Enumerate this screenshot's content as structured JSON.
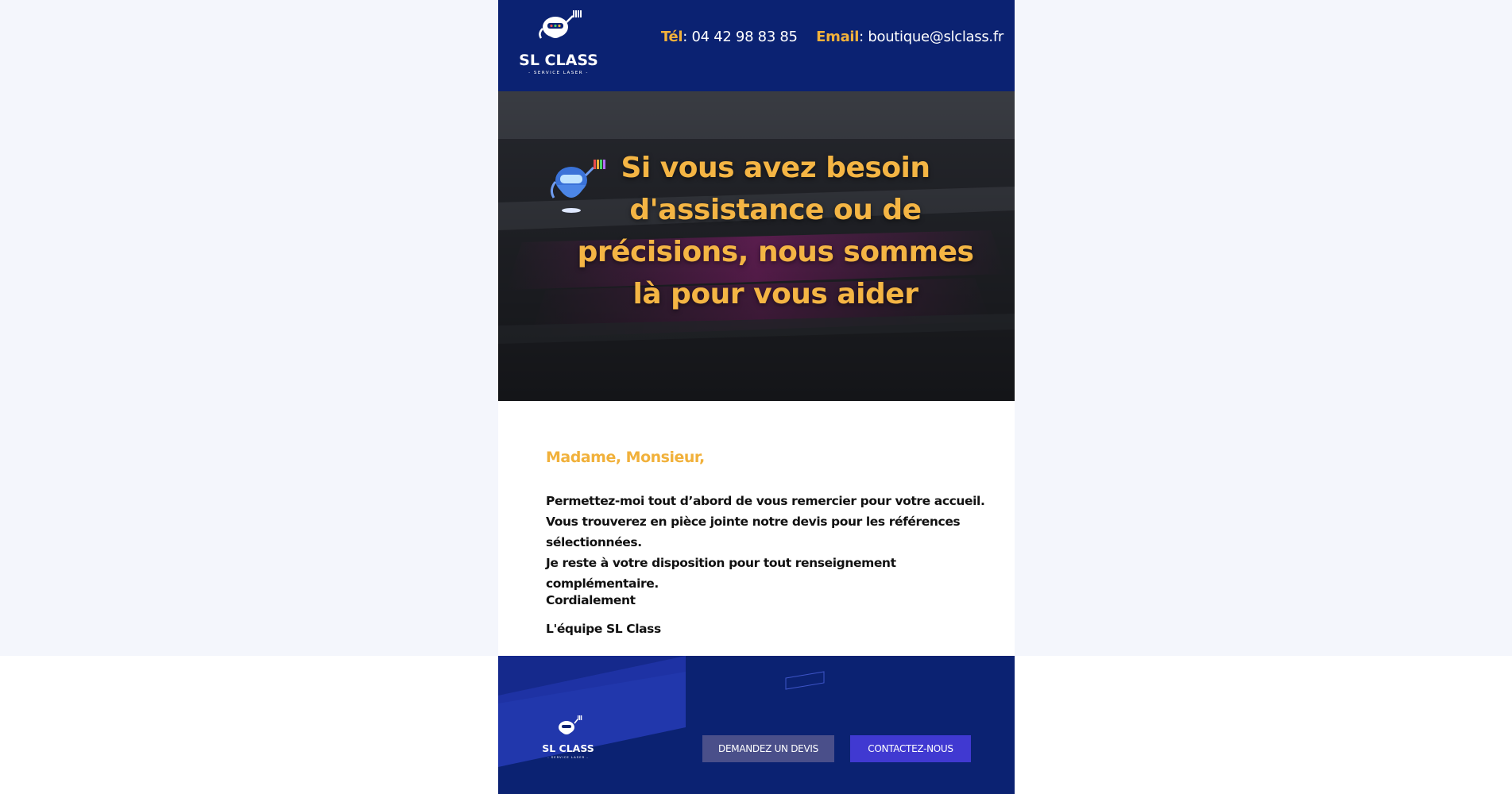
{
  "header": {
    "logo_alt": "SL CLASS - SERVICE LASER",
    "phone_label": "Tél",
    "phone_value": ": 04 42 98 83 85",
    "email_label": "Email",
    "email_value": ": boutique@slclass.fr"
  },
  "hero": {
    "title": "Si vous avez besoin d'assistance ou de précisions, nous sommes là pour vous aider"
  },
  "body": {
    "greeting": "Madame, Monsieur,",
    "lines": [
      "Permettez-moi tout d’abord de vous remercier pour votre accueil.",
      "Vous trouverez en pièce jointe notre devis pour les références sélectionnées.",
      "Je reste à votre disposition pour tout renseignement complémentaire."
    ],
    "closing": "Cordialement",
    "signature": "L'équipe SL Class"
  },
  "footer": {
    "quote_button": "DEMANDEZ UN DEVIS",
    "contact_button": "CONTACTEZ-NOUS"
  },
  "colors": {
    "navy": "#0b2272",
    "accent": "#f1b13b",
    "button_quote": "#4a4f8a",
    "button_contact": "#4039d1"
  },
  "icons": [
    "robot-logo-icon",
    "robot-mascot-icon"
  ]
}
